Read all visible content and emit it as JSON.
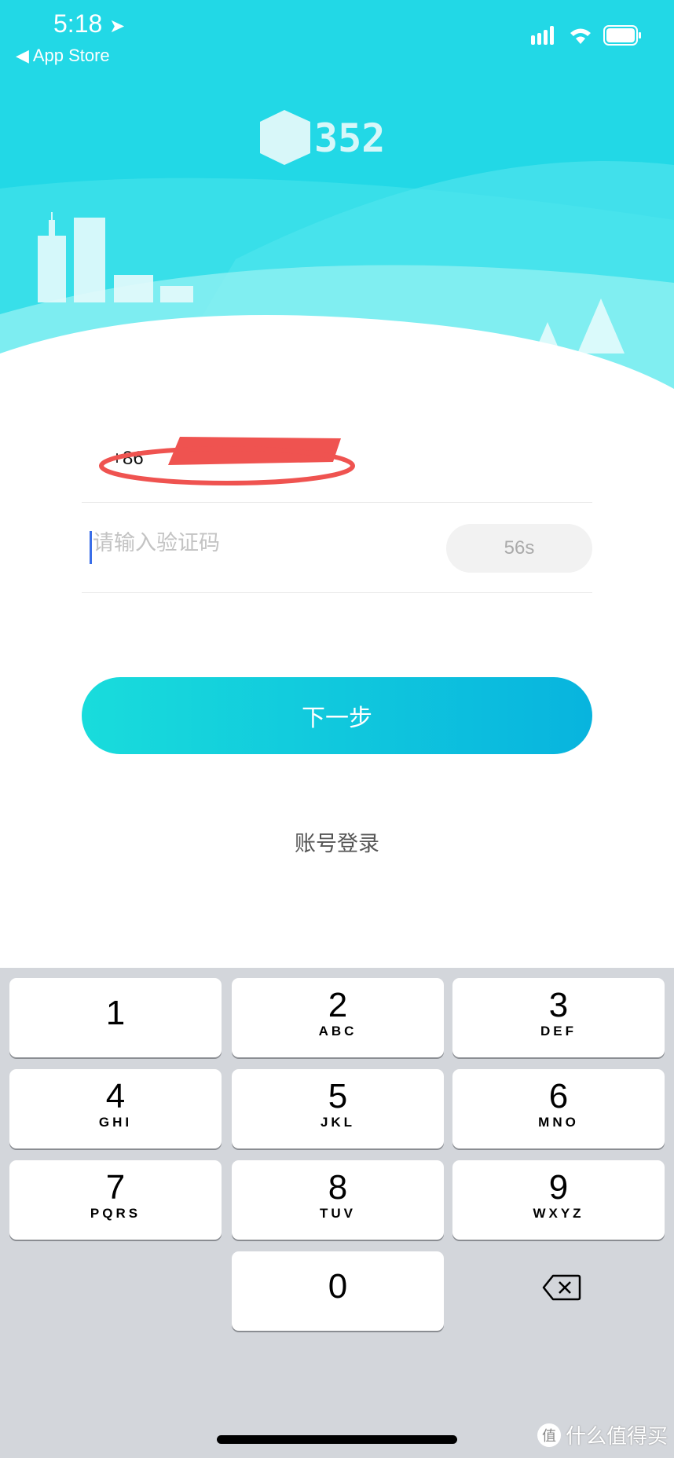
{
  "status_bar": {
    "time": "5:18",
    "back_label": "App Store"
  },
  "colors": {
    "sky": "#22d8e6",
    "button_start": "#19dcdc",
    "button_end": "#08b4de",
    "keyboard_bg": "#d3d6db"
  },
  "logo": {
    "text": "352"
  },
  "form": {
    "phone_value": "+86",
    "code_placeholder": "请输入验证码",
    "countdown": "56s",
    "next_label": "下一步",
    "account_login_label": "账号登录"
  },
  "keyboard": {
    "keys": [
      {
        "num": "1",
        "letters": ""
      },
      {
        "num": "2",
        "letters": "ABC"
      },
      {
        "num": "3",
        "letters": "DEF"
      },
      {
        "num": "4",
        "letters": "GHI"
      },
      {
        "num": "5",
        "letters": "JKL"
      },
      {
        "num": "6",
        "letters": "MNO"
      },
      {
        "num": "7",
        "letters": "PQRS"
      },
      {
        "num": "8",
        "letters": "TUV"
      },
      {
        "num": "9",
        "letters": "WXYZ"
      },
      {
        "num": "0",
        "letters": ""
      }
    ]
  },
  "watermark": {
    "icon_char": "值",
    "text": "什么值得买"
  }
}
